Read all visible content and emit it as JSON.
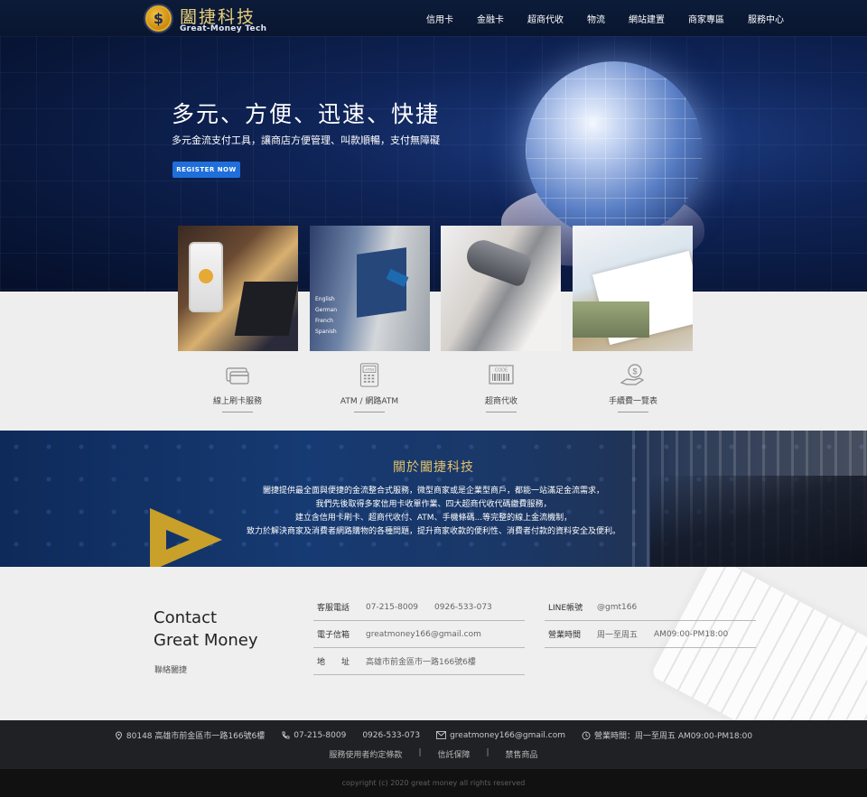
{
  "brand": {
    "name_cn": "闔捷科技",
    "name_en": "Great-Money Tech",
    "coin_symbol": "$"
  },
  "nav": {
    "items": [
      "信用卡",
      "金融卡",
      "超商代收",
      "物流",
      "網站建置",
      "商家專區",
      "服務中心"
    ]
  },
  "hero": {
    "title": "多元、方便、迅速、快捷",
    "subtitle": "多元金流支付工具，讓商店方便管理、叫款順暢，支付無障礙",
    "cta": "REGISTER NOW"
  },
  "atm_tile_text": [
    "English",
    "German",
    "French",
    "Spanish"
  ],
  "services": [
    {
      "label": "線上刷卡服務",
      "icon": "credit-card-icon"
    },
    {
      "label": "ATM / 網路ATM",
      "icon": "atm-icon"
    },
    {
      "label": "超商代收",
      "icon": "barcode-icon"
    },
    {
      "label": "手續費一覽表",
      "icon": "coin-hand-icon"
    }
  ],
  "service_icon_text": {
    "atm": "ATM",
    "code": "CODE"
  },
  "about": {
    "title": "關於闔捷科技",
    "lines": [
      "闔捷提供最全面與便捷的金流整合式服務，微型商家或是企業型商戶，都能一站滿足金流需求，",
      "我們先後取得多家信用卡收單作業、四大超商代收代碼繳費服務，",
      "建立含信用卡刷卡、超商代收付、ATM、手機條碼...等完整的線上金流機制，",
      "致力於解決商家及消費者網路購物的各種問題，提升商家收款的便利性、消費者付款的資料安全及便利。"
    ]
  },
  "contact": {
    "title_line1": "Contact",
    "title_line2": "Great Money",
    "subtitle": "聯絡闔捷",
    "phone_label": "客服電話",
    "phone_1": "07-215-8009",
    "phone_2": "0926-533-073",
    "email_label": "電子信箱",
    "email": "greatmoney166@gmail.com",
    "address_label": "地　　址",
    "address": "高雄市前金區市一路166號6樓",
    "line_label": "LINE帳號",
    "line_id": "@gmt166",
    "hours_label": "營業時間",
    "hours_days": "周一至周五",
    "hours_time": "AM09:00-PM18:00"
  },
  "footer": {
    "address": "80148 高雄市前金區市一路166號6樓",
    "phone_1": "07-215-8009",
    "phone_2": "0926-533-073",
    "email": "greatmoney166@gmail.com",
    "hours": "營業時間：周一至周五 AM09:00-PM18:00",
    "links": [
      "服務使用者約定條款",
      "信託保障",
      "禁售商品"
    ],
    "link_separator": "|",
    "copyright": "copyright (c) 2020 great money all rights reserved"
  },
  "colors": {
    "accent_blue": "#1f6fdb",
    "gold": "#e0c36a",
    "nav_bg": "#0b1b38",
    "footer_bg": "#202124"
  }
}
